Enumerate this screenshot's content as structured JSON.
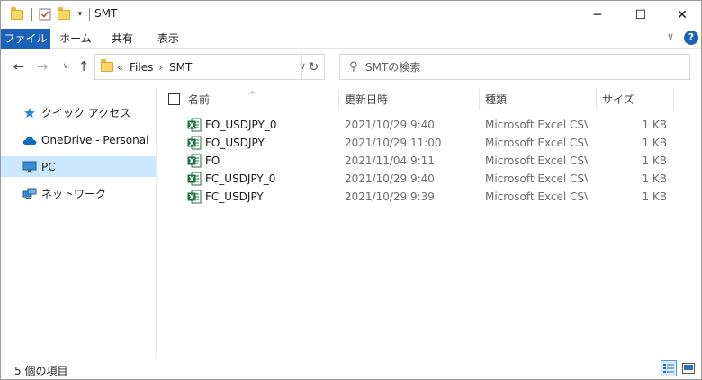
{
  "window": {
    "title": "SMT",
    "controls": {
      "minimize": "─",
      "maximize": "☐",
      "close": "✕"
    }
  },
  "ribbon": {
    "tabs": [
      "ファイル",
      "ホーム",
      "共有",
      "表示"
    ],
    "help": "?"
  },
  "address": {
    "overflow": "«",
    "crumbs": [
      "Files",
      "SMT"
    ],
    "separator": "›"
  },
  "search": {
    "placeholder": "SMTの検索"
  },
  "nav": {
    "items": [
      {
        "label": "クイック アクセス",
        "icon": "star-icon"
      },
      {
        "label": "OneDrive - Personal",
        "icon": "cloud-icon"
      },
      {
        "label": "PC",
        "icon": "monitor-icon",
        "selected": true
      },
      {
        "label": "ネットワーク",
        "icon": "network-icon"
      }
    ]
  },
  "columns": {
    "name": "名前",
    "date": "更新日時",
    "type": "種類",
    "size": "サイズ"
  },
  "files": [
    {
      "name": "FO_USDJPY_0",
      "date": "2021/10/29 9:40",
      "type": "Microsoft Excel CSV ...",
      "size": "1 KB"
    },
    {
      "name": "FO_USDJPY",
      "date": "2021/10/29 11:00",
      "type": "Microsoft Excel CSV ...",
      "size": "1 KB"
    },
    {
      "name": "FO",
      "date": "2021/11/04 9:11",
      "type": "Microsoft Excel CSV ...",
      "size": "1 KB"
    },
    {
      "name": "FC_USDJPY_0",
      "date": "2021/10/29 9:40",
      "type": "Microsoft Excel CSV ...",
      "size": "1 KB"
    },
    {
      "name": "FC_USDJPY",
      "date": "2021/10/29 9:39",
      "type": "Microsoft Excel CSV ...",
      "size": "1 KB"
    }
  ],
  "status": {
    "item_count": "5 個の項目"
  },
  "colors": {
    "accent": "#1a62b6",
    "selected_bg": "#cce8ff",
    "excel_green": "#1e7145",
    "folder_yellow": "#f7d66b"
  }
}
